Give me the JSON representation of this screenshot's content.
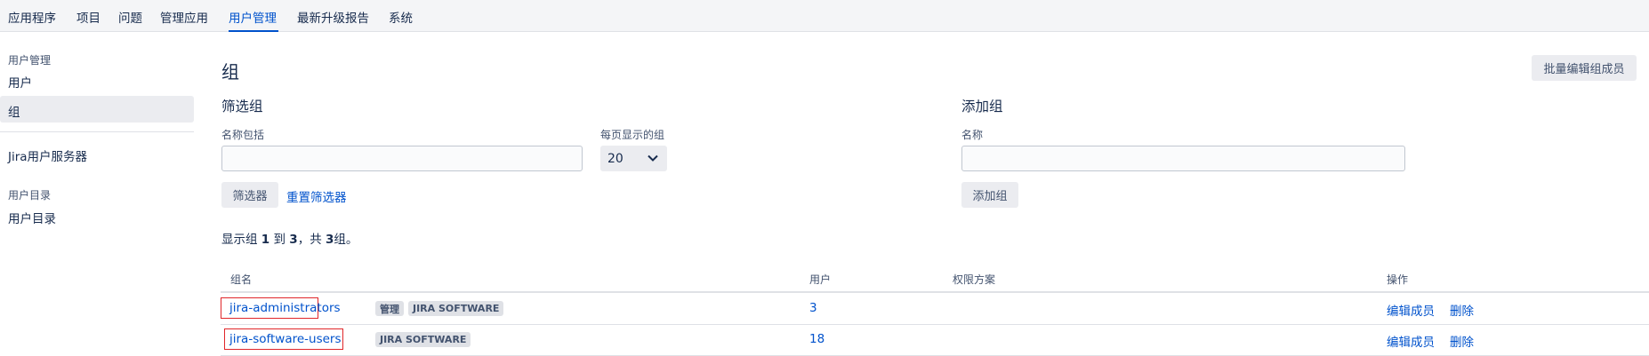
{
  "topnav": {
    "items": [
      "应用程序",
      "项目",
      "问题",
      "管理应用",
      "用户管理",
      "最新升级报告",
      "系统"
    ],
    "active": "用户管理"
  },
  "sidebar": {
    "section1_heading": "用户管理",
    "item_users": "用户",
    "item_groups": "组",
    "item_jira_server": "Jira用户服务器",
    "section2_heading": "用户目录",
    "item_directories": "用户目录"
  },
  "page": {
    "title": "组",
    "bulk_edit_label": "批量编辑组成员"
  },
  "filter": {
    "title": "筛选组",
    "name_label": "名称包括",
    "name_value": "",
    "per_page_label": "每页显示的组",
    "per_page_value": "20",
    "filter_button": "筛选器",
    "reset_link": "重置筛选器"
  },
  "add_group": {
    "title": "添加组",
    "name_label": "名称",
    "name_value": "",
    "add_button": "添加组"
  },
  "summary": {
    "prefix": "显示组 ",
    "from": "1",
    "middle": " 到 ",
    "to": "3",
    "sep": "，共 ",
    "total": "3",
    "suffix": "组。"
  },
  "table": {
    "headers": {
      "name": "组名",
      "users": "用户",
      "scheme": "权限方案",
      "actions": "操作"
    },
    "rows": [
      {
        "name": "jira-administrators",
        "tags": [
          "管理",
          "JIRA SOFTWARE"
        ],
        "users": "3",
        "scheme": "",
        "edit": "编辑成员",
        "delete": "删除"
      },
      {
        "name": "jira-software-users",
        "tags": [
          "JIRA SOFTWARE"
        ],
        "users": "18",
        "scheme": "",
        "edit": "编辑成员",
        "delete": "删除"
      }
    ]
  },
  "colors": {
    "link": "#0052cc",
    "highlight_box": "#e0262a",
    "nav_bg": "#f4f5f7"
  }
}
